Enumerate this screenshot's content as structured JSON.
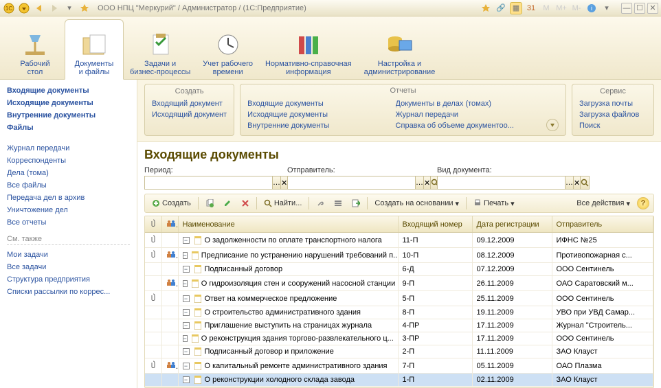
{
  "titlebar": {
    "title": "ООО НПЦ \"Меркурий\" / Администратор / (1С:Предприятие)",
    "letters": [
      "М",
      "М+",
      "М-"
    ]
  },
  "sections": [
    {
      "label": "Рабочий\nстол"
    },
    {
      "label": "Документы\nи файлы",
      "active": true
    },
    {
      "label": "Задачи и\nбизнес-процессы"
    },
    {
      "label": "Учет рабочего\nвремени"
    },
    {
      "label": "Нормативно-справочная\nинформация"
    },
    {
      "label": "Настройка и\nадминистрирование"
    }
  ],
  "left_nav": {
    "primary": [
      "Входящие документы",
      "Исходящие документы",
      "Внутренние документы",
      "Файлы"
    ],
    "secondary": [
      "Журнал передачи",
      "Корреспонденты",
      "Дела (тома)",
      "Все файлы",
      "Передача дел в архив",
      "Уничтожение дел",
      "Все отчеты"
    ],
    "see_also_title": "См. также",
    "see_also": [
      "Мои задачи",
      "Все задачи",
      "Структура предприятия",
      "Списки рассылки по коррес..."
    ]
  },
  "actions": {
    "create": {
      "title": "Создать",
      "items": [
        "Входящий документ",
        "Исходящий документ"
      ]
    },
    "reports": {
      "title": "Отчеты",
      "cols": [
        [
          "Входящие документы",
          "Исходящие документы",
          "Внутренние документы"
        ],
        [
          "Документы в делах (томах)",
          "Журнал передачи",
          "Справка об объеме документоо..."
        ]
      ]
    },
    "service": {
      "title": "Сервис",
      "items": [
        "Загрузка почты",
        "Загрузка файлов",
        "Поиск"
      ]
    }
  },
  "page": {
    "title": "Входящие документы",
    "filters": {
      "period": {
        "label": "Период:",
        "value": ""
      },
      "sender": {
        "label": "Отправитель:",
        "value": ""
      },
      "kind": {
        "label": "Вид документа:",
        "value": ""
      }
    },
    "toolbar": {
      "create": "Создать",
      "find": "Найти...",
      "create_based": "Создать на основании",
      "print": "Печать",
      "all_actions": "Все действия"
    },
    "columns": [
      "",
      "",
      "Наименование",
      "Входящий номер",
      "Дата регистрации",
      "Отправитель"
    ],
    "rows": [
      {
        "clip": true,
        "users": false,
        "name": "О задолженности по оплате транспортного налога",
        "num": "11-П",
        "date": "09.12.2009",
        "sender": "ИФНС №25"
      },
      {
        "clip": true,
        "users": true,
        "name": "Предписание по устранению нарушений требований п...",
        "num": "10-П",
        "date": "08.12.2009",
        "sender": "Противопожарная с..."
      },
      {
        "clip": false,
        "users": false,
        "name": "Подписанный договор",
        "num": "6-Д",
        "date": "07.12.2009",
        "sender": "ООО Сентинель"
      },
      {
        "clip": false,
        "users": true,
        "name": "О гидроизоляция стен и сооружений насосной станции",
        "num": "9-П",
        "date": "26.11.2009",
        "sender": "ОАО Саратовский м..."
      },
      {
        "clip": true,
        "users": false,
        "name": "Ответ на коммерческое предложение",
        "num": "5-П",
        "date": "25.11.2009",
        "sender": "ООО Сентинель"
      },
      {
        "clip": false,
        "users": false,
        "name": "О строительство административного здания",
        "num": "8-П",
        "date": "19.11.2009",
        "sender": "УВО при УВД Самар..."
      },
      {
        "clip": false,
        "users": false,
        "name": "Приглашение выступить на страницах журнала",
        "num": "4-ПР",
        "date": "17.11.2009",
        "sender": "Журнал \"Строитель..."
      },
      {
        "clip": false,
        "users": false,
        "name": "О реконструкция здания торгово-развлекательного ц...",
        "num": "3-ПР",
        "date": "17.11.2009",
        "sender": "ООО Сентинель"
      },
      {
        "clip": false,
        "users": false,
        "name": "Подписанный договор и приложение",
        "num": "2-П",
        "date": "11.11.2009",
        "sender": "ЗАО Клауст"
      },
      {
        "clip": true,
        "users": true,
        "name": "О капитальный ремонте административного здания",
        "num": "7-П",
        "date": "05.11.2009",
        "sender": "ОАО Плазма"
      },
      {
        "clip": false,
        "users": false,
        "name": "О реконструкции холодного склада завода",
        "num": "1-П",
        "date": "02.11.2009",
        "sender": "ЗАО Клауст",
        "selected": true
      }
    ]
  }
}
